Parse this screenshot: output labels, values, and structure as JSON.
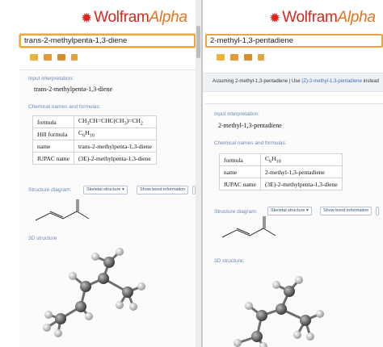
{
  "colors": {
    "brand_red": "#d9271e",
    "brand_orange": "#e5721f",
    "search_border": "#f0a53a",
    "section_title": "#6a8ab5"
  },
  "left": {
    "logo": {
      "word1": "Wolfram",
      "word2": "Alpha"
    },
    "search_value": "trans-2-methylpenta-1,3-diene",
    "input_interpretation": {
      "title": "Input interpretation:",
      "value": "trans-2-methylpenta-1,3-diene"
    },
    "chem": {
      "title": "Chemical names and formulas:",
      "rows": [
        {
          "label": "formula",
          "value": "CH3CH=CHC(CH3)=CH2"
        },
        {
          "label": "Hill formula",
          "value": "C6H10"
        },
        {
          "label": "name",
          "value": "trans-2-methylpenta-1,3-diene"
        },
        {
          "label": "IUPAC name",
          "value": "(3E)-2-methylpenta-1,3-diene"
        }
      ]
    },
    "structure": {
      "title": "Structure diagram:",
      "select": "Skeletal structure ▾",
      "bond_button": "Show bond information"
    },
    "structure3d": {
      "title": "3D structure"
    }
  },
  "right": {
    "logo": {
      "word1": "Wolfram",
      "word2": "Alpha"
    },
    "search_value": "2-methyl-1,3-pentadiene",
    "assuming": {
      "prefix": "Assuming 2-methyl-1,3-pentadiene | Use ",
      "link1": "(Z)-2-methyl-1,3-pentadiene",
      "suffix": " instead"
    },
    "input_interpretation": {
      "title": "Input interpretation:",
      "value": "2-methyl-1,3-pentadiene"
    },
    "chem": {
      "title": "Chemical names and formulas:",
      "rows": [
        {
          "label": "formula",
          "value": "C6H10"
        },
        {
          "label": "name",
          "value": "2-methyl-1,3-pentadiene"
        },
        {
          "label": "IUPAC name",
          "value": "(3E)-2-methylpenta-1,3-diene"
        }
      ]
    },
    "structure": {
      "title": "Structure diagram:",
      "select": "Skeletal structure ▾",
      "bond_button": "Show bond information"
    },
    "structure3d": {
      "title": "3D structure:"
    }
  }
}
